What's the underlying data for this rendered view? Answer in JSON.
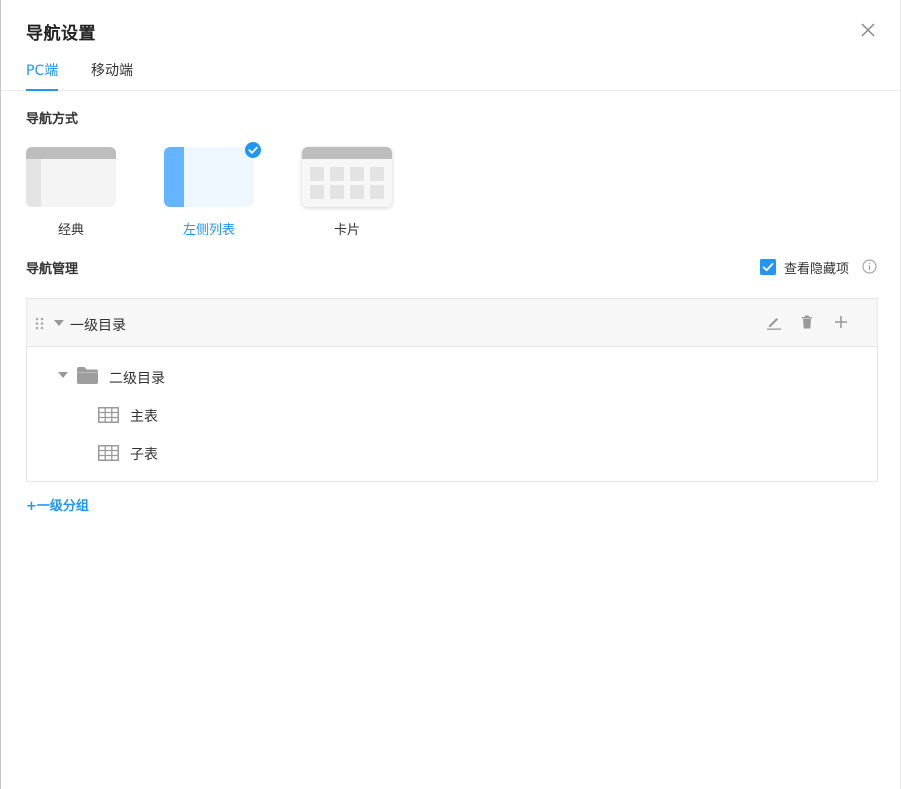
{
  "dialog": {
    "title": "导航设置",
    "close_icon": "close-icon"
  },
  "tabs": [
    {
      "label": "PC端",
      "active": true
    },
    {
      "label": "移动端",
      "active": false
    }
  ],
  "nav_mode": {
    "label": "导航方式",
    "options": [
      {
        "label": "经典",
        "selected": false
      },
      {
        "label": "左侧列表",
        "selected": true
      },
      {
        "label": "卡片",
        "selected": false
      }
    ]
  },
  "nav_manage": {
    "label": "导航管理",
    "show_hidden": {
      "label": "查看隐藏项",
      "checked": true
    },
    "tree": {
      "level1": {
        "label": "一级目录"
      },
      "level2": {
        "label": "二级目录"
      },
      "items": [
        {
          "label": "主表"
        },
        {
          "label": "子表"
        }
      ]
    },
    "add_group_label": "+一级分组"
  },
  "colors": {
    "accent": "#2196f3",
    "card_selected_side": "#63b5ff",
    "card_gray_bar": "#bdbdbd"
  }
}
